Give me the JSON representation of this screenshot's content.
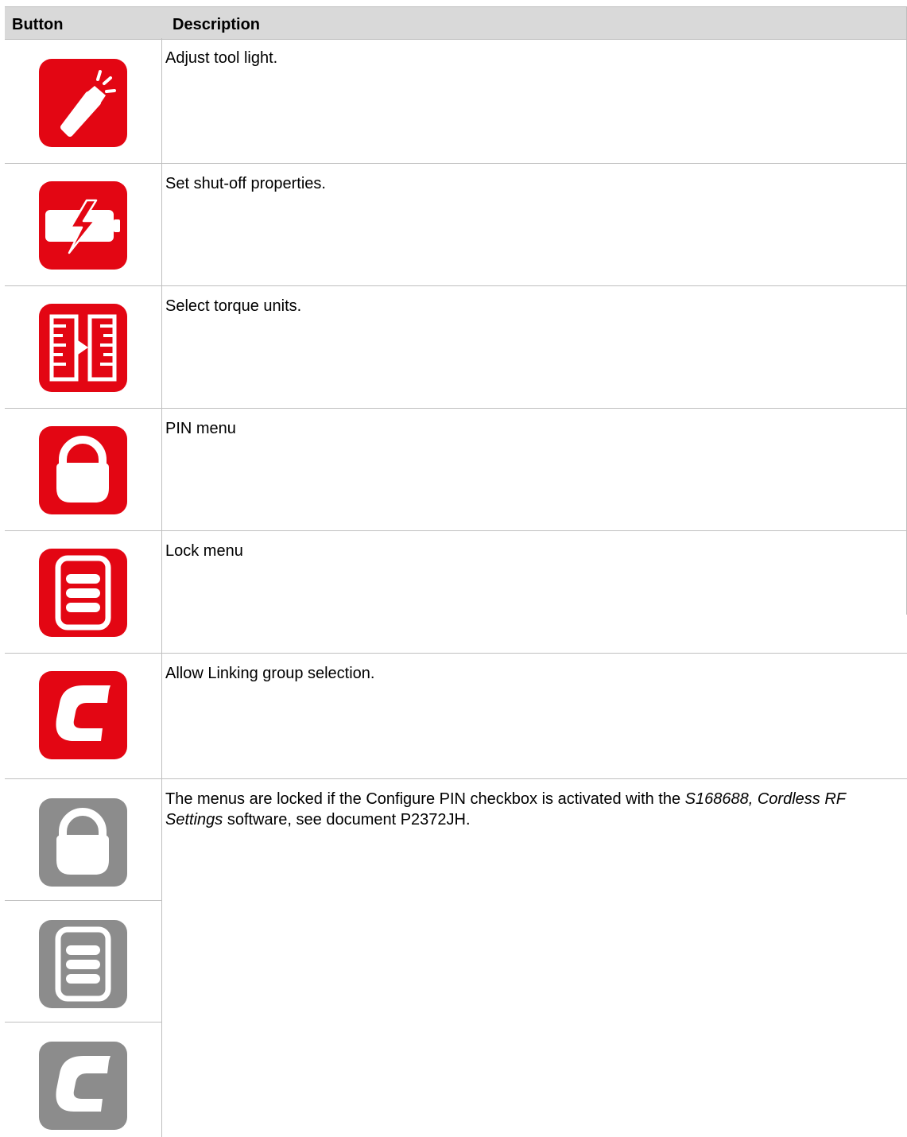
{
  "table": {
    "header": {
      "button": "Button",
      "description": "Description"
    },
    "rows": [
      {
        "description": "Adjust tool light.",
        "icon": "flashlight-icon",
        "color": "#e30613"
      },
      {
        "description": "Set shut-off properties.",
        "icon": "battery-charge-icon",
        "color": "#e30613"
      },
      {
        "description": "Select torque units.",
        "icon": "torque-units-icon",
        "color": "#e30613"
      },
      {
        "description": "PIN menu",
        "icon": "padlock-icon",
        "color": "#e30613"
      },
      {
        "description": "Lock menu",
        "icon": "lock-menu-icon",
        "color": "#e30613"
      },
      {
        "description": "Allow Linking group selection.",
        "icon": "linking-c-icon",
        "color": "#e30613"
      }
    ],
    "locked": {
      "text_a": "The menus are locked if the Configure PIN checkbox is activated with the ",
      "text_em": "S168688, Cordless RF Settings",
      "text_b": " software, see document P2372JH.",
      "icons": [
        "padlock-icon",
        "lock-menu-icon",
        "linking-c-icon"
      ],
      "color": "#8c8c8c"
    }
  }
}
